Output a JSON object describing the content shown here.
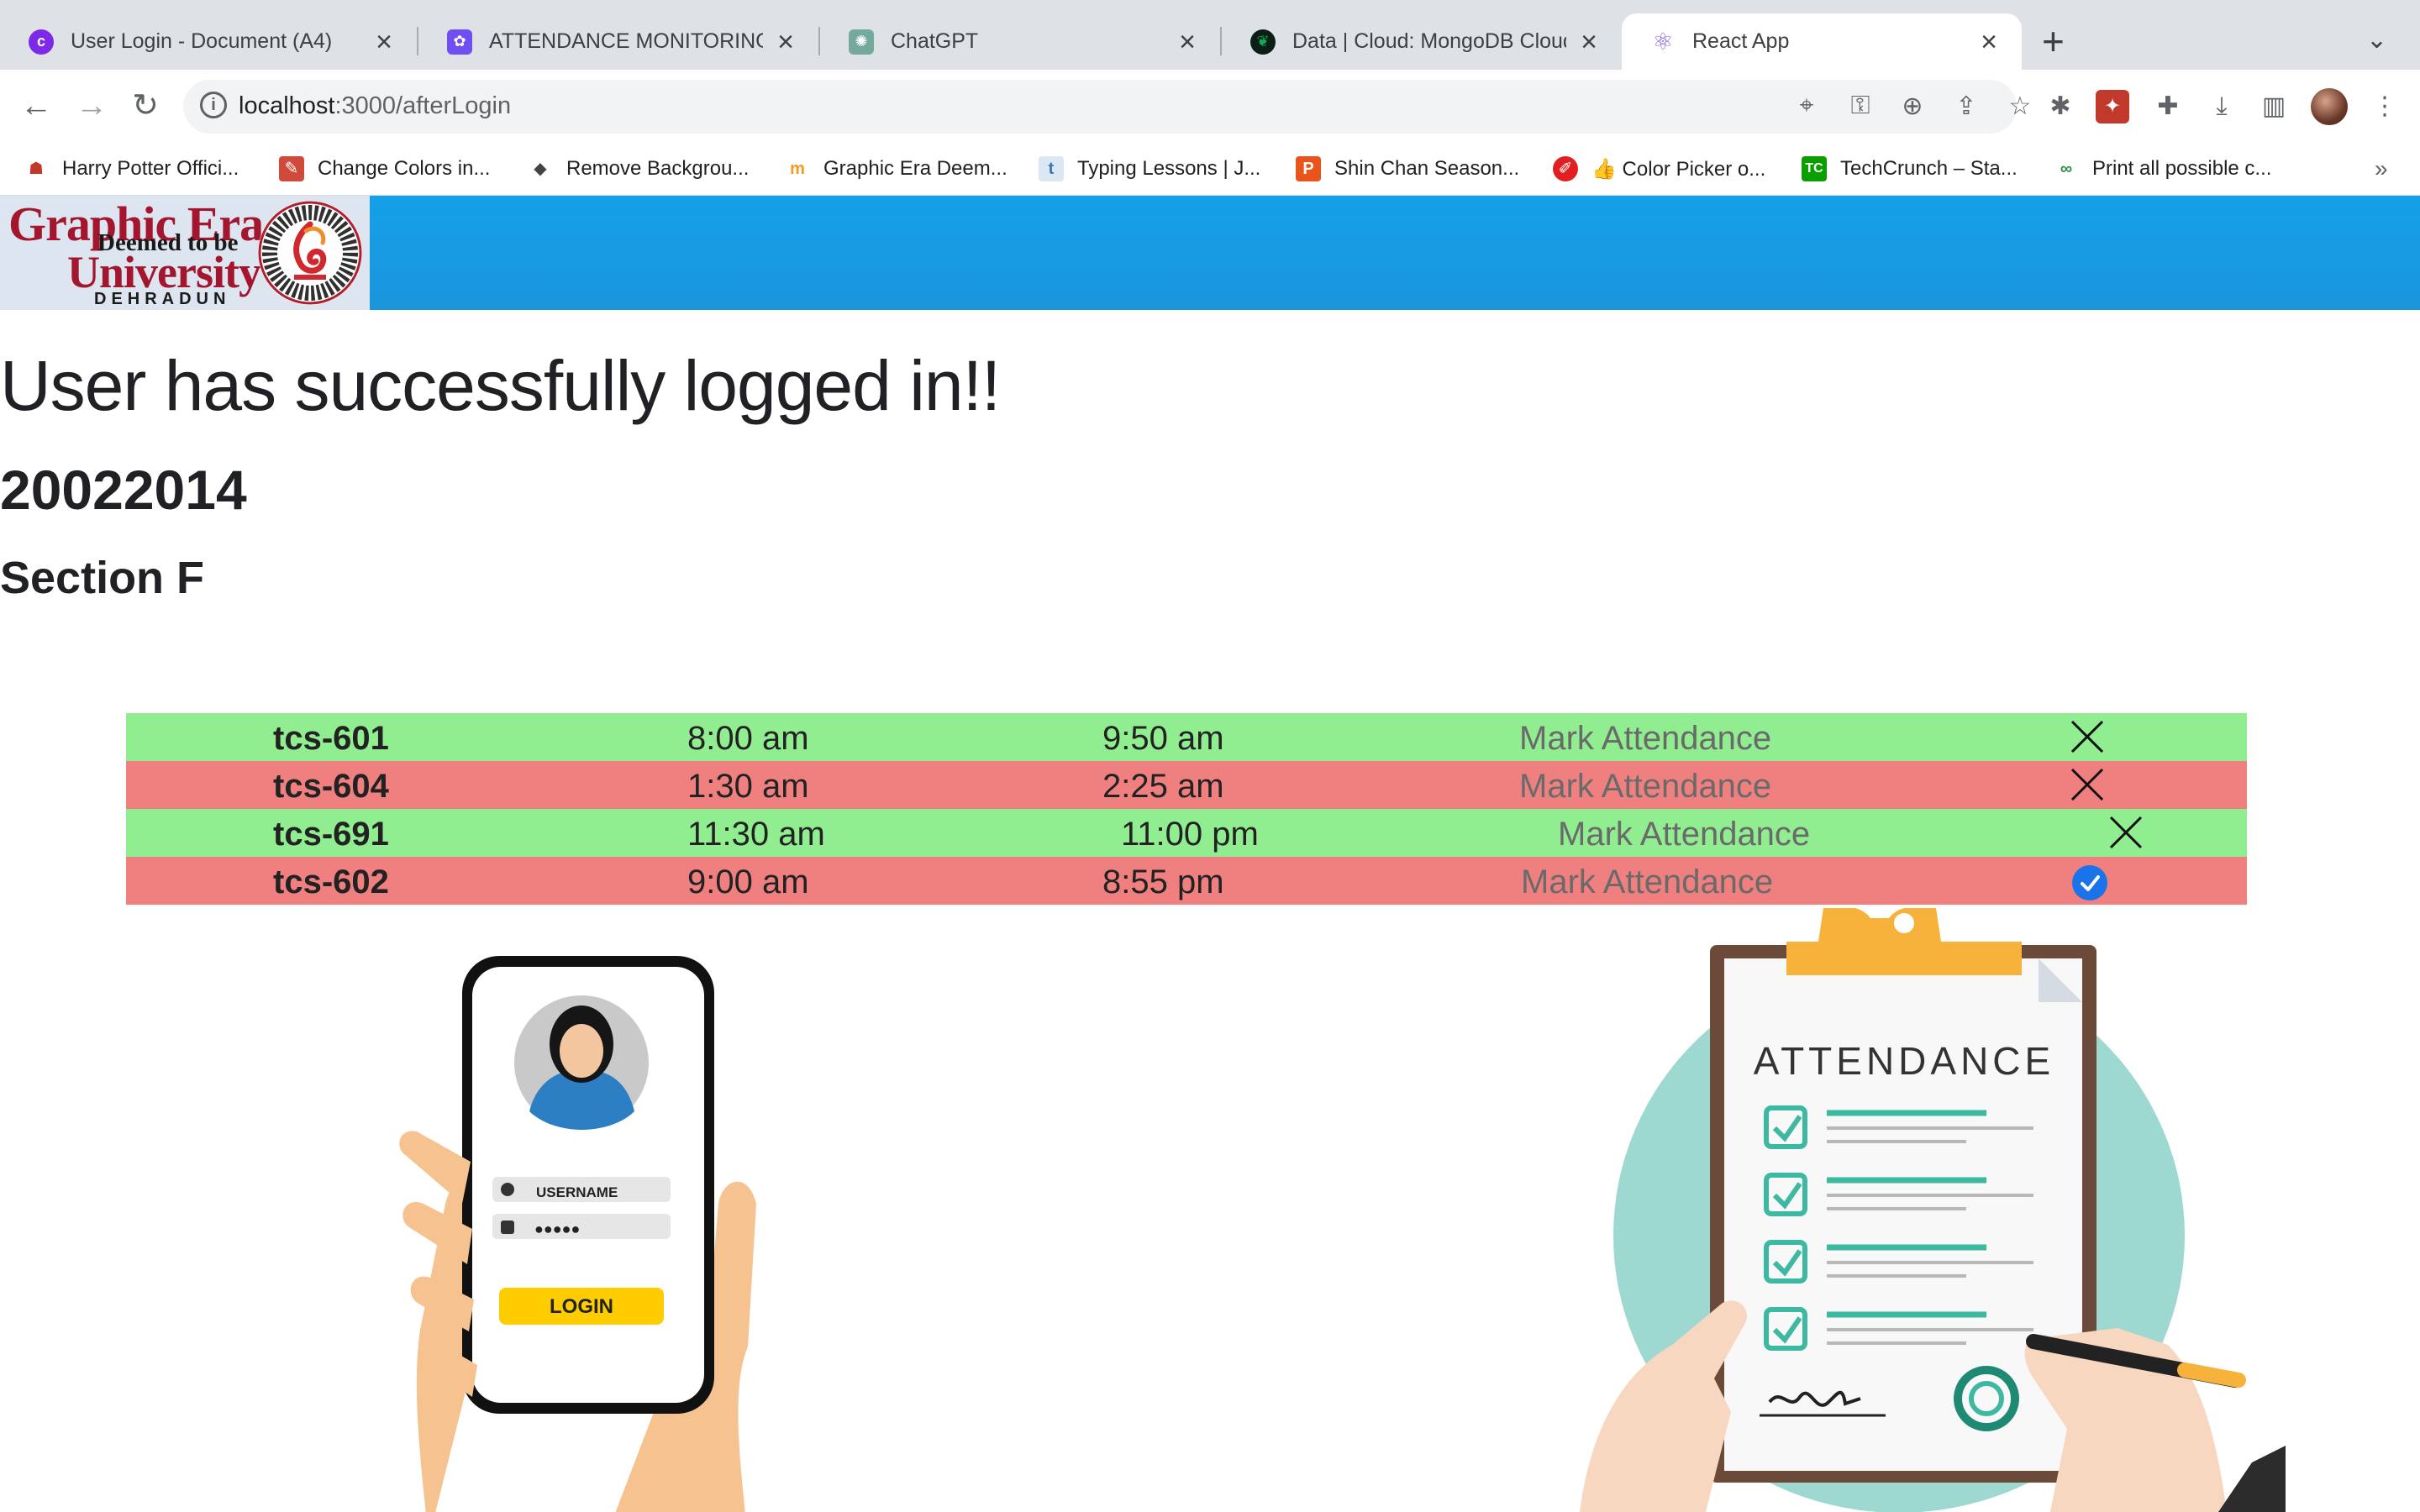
{
  "tabs": [
    {
      "title": "User Login - Document (A4)",
      "icon": "canva-icon",
      "color": "#7d2ae8"
    },
    {
      "title": "ATTENDANCE MONITORING S",
      "icon": "award-icon",
      "color": "#6f4ef2"
    },
    {
      "title": "ChatGPT",
      "icon": "chatgpt-icon",
      "color": "#74aa9c"
    },
    {
      "title": "Data | Cloud: MongoDB Cloud",
      "icon": "mongodb-icon",
      "color": "#00684a"
    },
    {
      "title": "React App",
      "icon": "react-icon",
      "color": "#8a6ad0"
    }
  ],
  "address_bar": {
    "host": "localhost",
    "rest": ":3000/afterLogin"
  },
  "bookmarks": [
    {
      "label": "Harry Potter Offici...",
      "icon": "ghost-icon",
      "color": "#c0392b"
    },
    {
      "label": "Change Colors in...",
      "icon": "paint-icon",
      "color": "#d04a3a"
    },
    {
      "label": "Remove Backgrou...",
      "icon": "layers-icon",
      "color": "#444444"
    },
    {
      "label": "Graphic Era Deem...",
      "icon": "moodle-icon",
      "color": "#f29b1d"
    },
    {
      "label": "Typing Lessons | J...",
      "icon": "typing-icon",
      "color": "#6aa8d8"
    },
    {
      "label": "Shin Chan Season...",
      "icon": "p-icon",
      "color": "#e8541b"
    },
    {
      "label": "👍 Color Picker o...",
      "icon": "picker-icon",
      "color": "#e02020"
    },
    {
      "label": "TechCrunch – Sta...",
      "icon": "techcrunch-icon",
      "color": "#0a9e01"
    },
    {
      "label": "Print all possible c...",
      "icon": "gfg-icon",
      "color": "#2f8d46"
    }
  ],
  "logo": {
    "line1": "Graphic Era",
    "line2": "Deemed to be",
    "line3": "University",
    "line4": "DEHRADUN"
  },
  "page": {
    "headline": "User has successfully logged in!!",
    "roll_no": "20022014",
    "section": "Section F"
  },
  "classes": [
    {
      "code": "tcs-601",
      "start": "8:00 am",
      "end": "9:50 am",
      "action": "Mark Attendance",
      "status": "absent",
      "color": "green"
    },
    {
      "code": "tcs-604",
      "start": "1:30 am",
      "end": "2:25 am",
      "action": "Mark Attendance",
      "status": "absent",
      "color": "red"
    },
    {
      "code": "tcs-691",
      "start": "11:30 am",
      "end": "11:00 pm",
      "action": "Mark Attendance",
      "status": "absent",
      "color": "green"
    },
    {
      "code": "tcs-602",
      "start": "9:00 am",
      "end": "8:55 pm",
      "action": "Mark Attendance",
      "status": "present",
      "color": "red"
    }
  ],
  "illustrations": {
    "phone": {
      "username_label": "USERNAME",
      "password_mask": "●●●●●",
      "login_label": "LOGIN"
    },
    "clipboard": {
      "heading": "ATTENDANCE"
    }
  },
  "colors": {
    "present_row": "#90ee90",
    "absent_row": "#f08080",
    "header": "#14a0e8",
    "check": "#1a73e8"
  }
}
